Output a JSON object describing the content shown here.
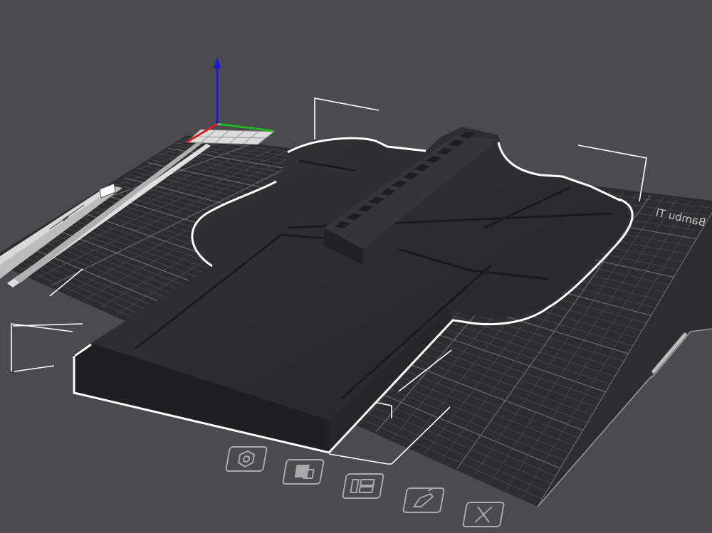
{
  "viewport": {
    "background": "#4b4b4f",
    "bed_color": "#2c2c2e",
    "grid_color": "#5a5a5e",
    "model_color": "#2b2b2d",
    "selection_outline_color": "#ffffff"
  },
  "bed": {
    "brand_text_mirrored": "Bambu Tl",
    "label_strip_text": "",
    "toolbar_icons": [
      {
        "name": "orient-icon",
        "tooltip": ""
      },
      {
        "name": "arrange-icon",
        "tooltip": ""
      },
      {
        "name": "layout-icon",
        "tooltip": ""
      },
      {
        "name": "edit-icon",
        "tooltip": ""
      },
      {
        "name": "delete-icon",
        "tooltip": ""
      }
    ]
  },
  "axes": {
    "x_color": "#d42020",
    "y_color": "#21b521",
    "z_color": "#1a1ad6"
  }
}
